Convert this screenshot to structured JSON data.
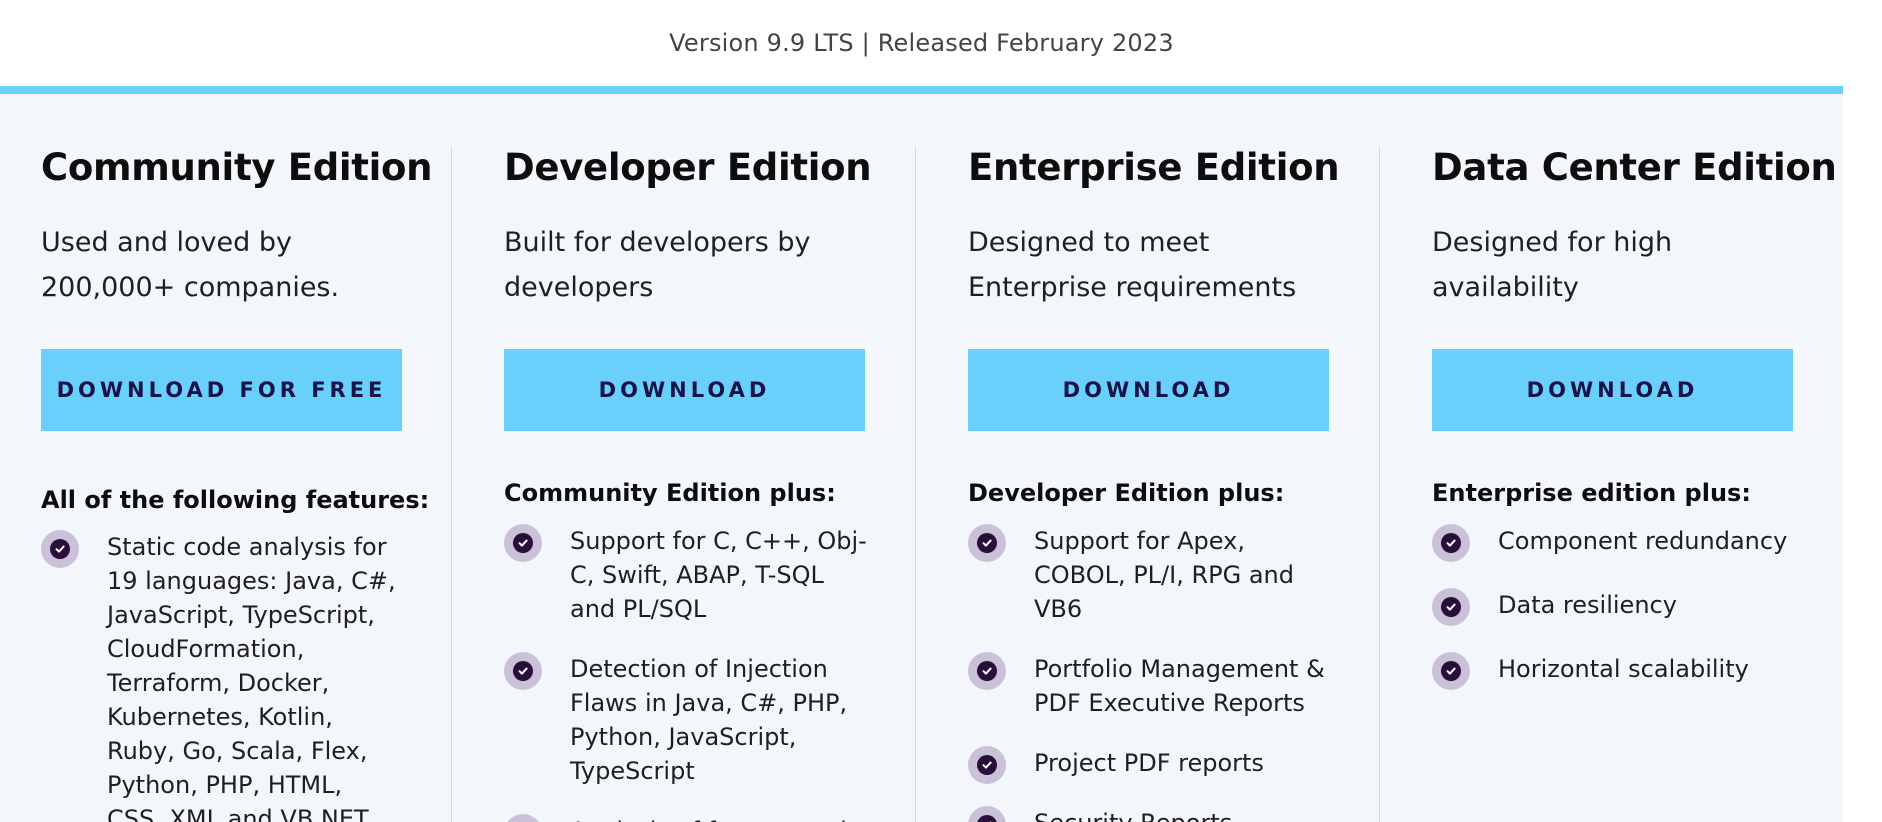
{
  "version": {
    "text": "Version 9.9 LTS | Released February 2023"
  },
  "editions": [
    {
      "title": "Community Edition",
      "desc_lines": [
        "Used and loved by",
        "200,000+ companies."
      ],
      "button": "DOWNLOAD FOR FREE",
      "plus": "All of the following features:",
      "features": [
        {
          "lines": [
            "Static code analysis for",
            "19 languages: Java, C#,",
            "JavaScript, TypeScript,",
            "CloudFormation,",
            "Terraform, Docker,",
            "Kubernetes, Kotlin,",
            "Ruby, Go, Scala, Flex,",
            "Python, PHP, HTML,",
            "CSS, XML and VB.NET"
          ]
        }
      ]
    },
    {
      "title": "Developer Edition",
      "desc_lines": [
        "Built for developers by",
        "developers"
      ],
      "button": "DOWNLOAD",
      "plus": "Community Edition plus:",
      "features": [
        {
          "lines": [
            "Support for C, C++, Obj-",
            "C, Swift, ABAP, T-SQL",
            "and PL/SQL"
          ]
        },
        {
          "lines": [
            "Detection of Injection",
            "Flaws in Java, C#, PHP,",
            "Python, JavaScript,",
            "TypeScript"
          ]
        },
        {
          "lines": [
            "Analysis of feature and"
          ]
        }
      ]
    },
    {
      "title": "Enterprise Edition",
      "desc_lines": [
        "Designed to meet",
        "Enterprise requirements"
      ],
      "button": "DOWNLOAD",
      "plus": "Developer Edition plus:",
      "features": [
        {
          "lines": [
            "Support for Apex,",
            "COBOL, PL/I, RPG and",
            "VB6"
          ]
        },
        {
          "lines": [
            "Portfolio Management &",
            "PDF Executive Reports"
          ]
        },
        {
          "lines": [
            "Project PDF reports"
          ]
        },
        {
          "lines": [
            "Security Reports"
          ]
        }
      ]
    },
    {
      "title": "Data Center Edition",
      "desc_lines": [
        "Designed for high",
        "availability"
      ],
      "button": "DOWNLOAD",
      "plus": "Enterprise edition plus:",
      "features": [
        {
          "lines": [
            "Component redundancy"
          ]
        },
        {
          "lines": [
            "Data resiliency"
          ]
        },
        {
          "lines": [
            "Horizontal scalability"
          ]
        }
      ]
    }
  ],
  "colors": {
    "accent": "#69d0fb",
    "button_text": "#1a1348",
    "check_outer": "#c9c1d8",
    "check_inner": "#2a0f3d",
    "panel_bg": "#f3f6fb"
  }
}
